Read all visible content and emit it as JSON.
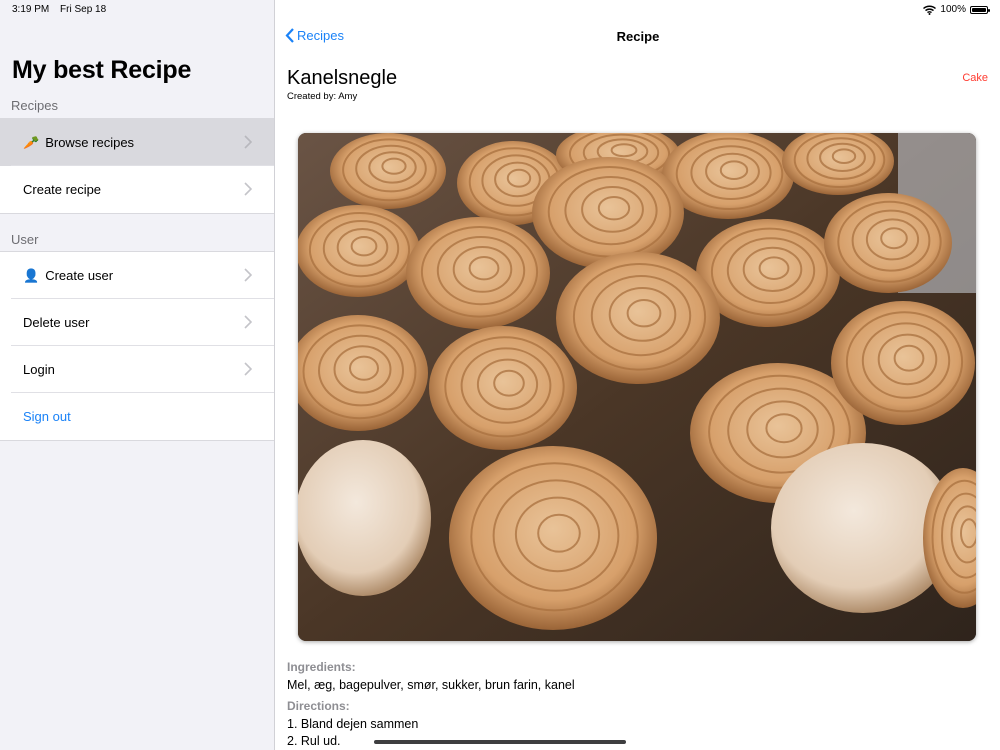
{
  "status": {
    "time": "3:19 PM",
    "date": "Fri Sep 18",
    "battery": "100%",
    "battery_level": 1.0
  },
  "sidebar": {
    "title": "My best Recipe",
    "sections": [
      {
        "header": "Recipes",
        "items": [
          {
            "emoji": "🥕",
            "label": "Browse recipes",
            "selected": true
          },
          {
            "label": "Create recipe"
          }
        ]
      },
      {
        "header": "User",
        "items": [
          {
            "emoji": "👤",
            "label": "Create user"
          },
          {
            "label": "Delete user"
          },
          {
            "label": "Login"
          },
          {
            "label": "Sign out",
            "link": true
          }
        ]
      }
    ]
  },
  "nav": {
    "back_label": "Recipes",
    "title": "Recipe"
  },
  "recipe": {
    "name": "Kanelsnegle",
    "created_by": "Created by: Amy",
    "category": "Cake",
    "ingredients_label": "Ingredients:",
    "ingredients": "Mel, æg, bagepulver, smør, sukker, brun farin, kanel",
    "directions_label": "Directions:",
    "directions": [
      "1. Bland dejen sammen",
      "2. Rul ud."
    ]
  },
  "colors": {
    "accent": "#1a82f7",
    "category": "#ff3b30"
  }
}
